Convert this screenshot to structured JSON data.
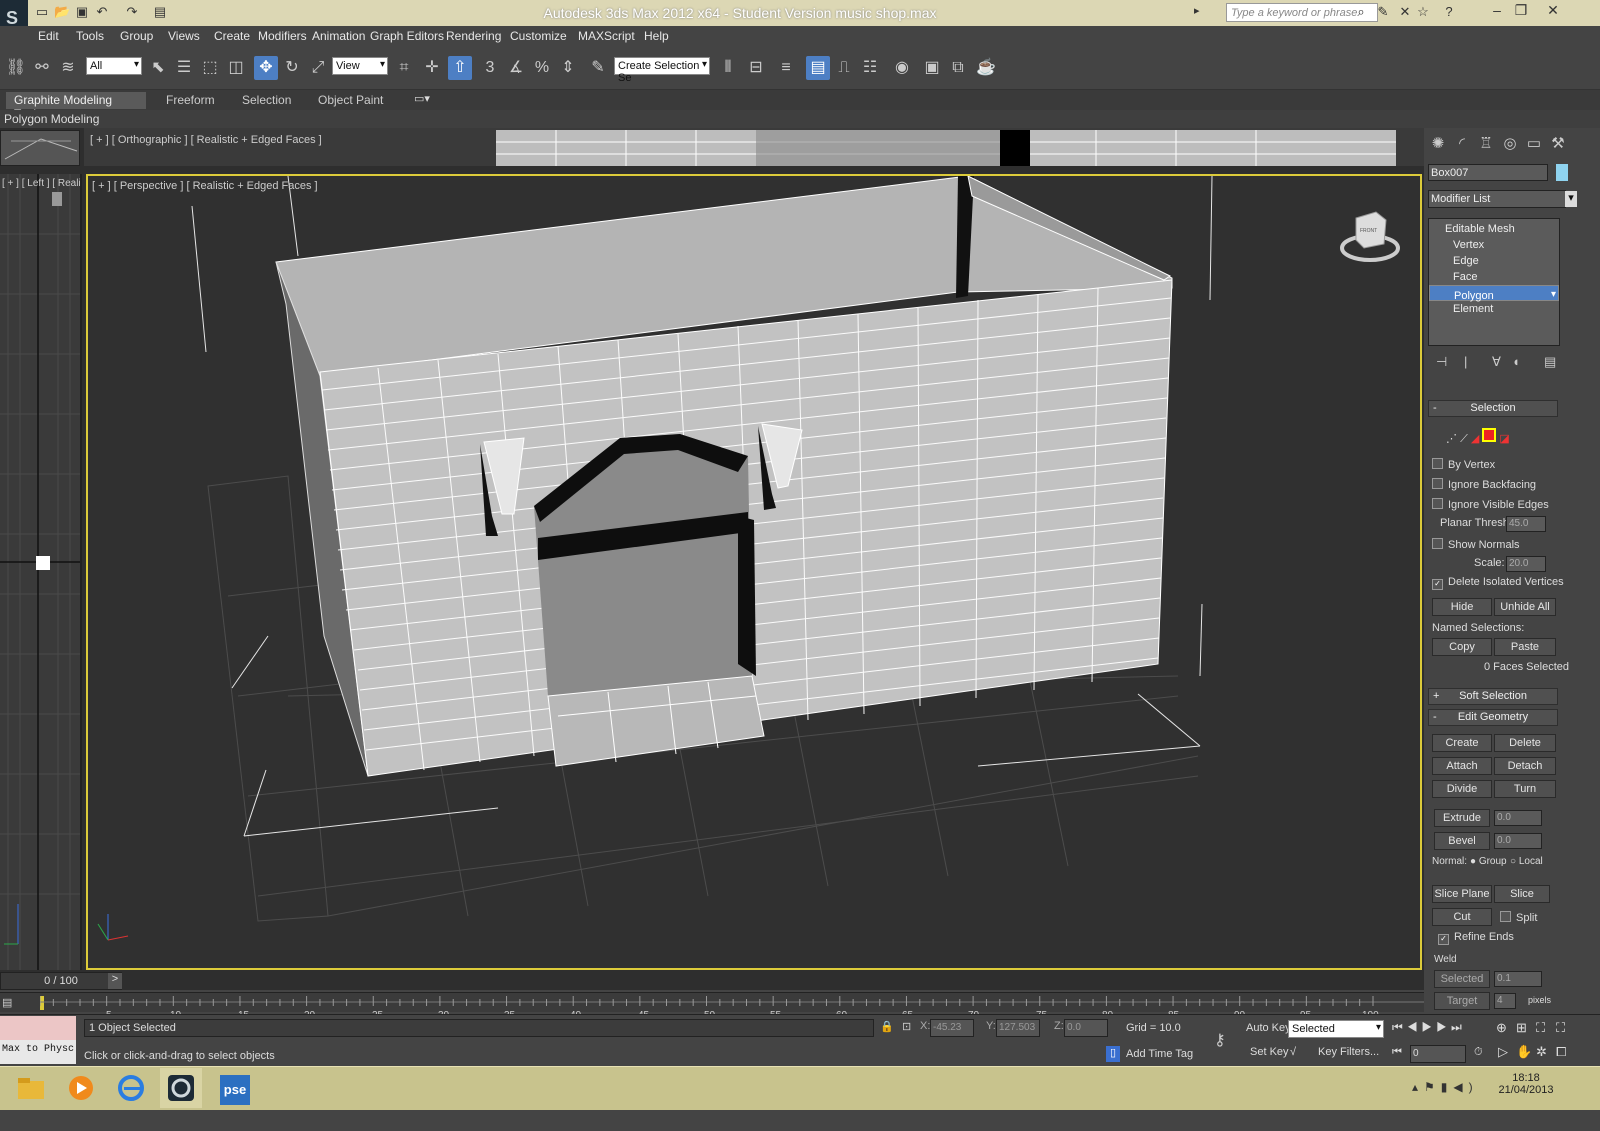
{
  "window": {
    "title": "Autodesk 3ds Max  2012 x64  - Student Version    music shop.max",
    "search_placeholder": "Type a keyword or phrase",
    "logo_letter": "S"
  },
  "menu": [
    "Edit",
    "Tools",
    "Group",
    "Views",
    "Create",
    "Modifiers",
    "Animation",
    "Graph Editors",
    "Rendering",
    "Customize",
    "MAXScript",
    "Help"
  ],
  "toolbar": {
    "selection_filter": "All",
    "ref_coord": "View",
    "named_selection": "Create Selection Se",
    "snap_3": "3",
    "snap_percent": "%"
  },
  "ribbon": {
    "tabs": [
      "Graphite Modeling Tools",
      "Freeform",
      "Selection",
      "Object Paint"
    ],
    "subpanel": "Polygon Modeling"
  },
  "viewports": {
    "ortho_label": "[ + ] [ Orthographic ] [ Realistic + Edged Faces ]",
    "left_label": "[ + ] [ Left ] [ Realisti",
    "persp_label": "[ + ] [ Perspective ] [ Realistic + Edged Faces ]",
    "viewcube_label": "FRONT"
  },
  "command_panel": {
    "object_name": "Box007",
    "object_color": "#8fd3ef",
    "modifier_list": "Modifier List",
    "stack": [
      {
        "label": "Editable Mesh",
        "top": true
      },
      {
        "label": "Vertex"
      },
      {
        "label": "Edge"
      },
      {
        "label": "Face"
      },
      {
        "label": "Polygon",
        "selected": true
      },
      {
        "label": "Element"
      }
    ],
    "selection": {
      "header": "Selection",
      "by_vertex": "By Vertex",
      "ignore_backfacing": "Ignore Backfacing",
      "ignore_visible_edges": "Ignore Visible Edges",
      "planar_thresh_label": "Planar Thresh:",
      "planar_thresh": "45.0",
      "show_normals": "Show Normals",
      "scale_label": "Scale:",
      "scale": "20.0",
      "delete_isolated": "Delete Isolated Vertices",
      "hide": "Hide",
      "unhide_all": "Unhide All",
      "named_selections": "Named Selections:",
      "copy": "Copy",
      "paste": "Paste",
      "faces_selected": "0 Faces Selected"
    },
    "soft_selection": "Soft Selection",
    "edit_geometry": {
      "header": "Edit Geometry",
      "create": "Create",
      "delete": "Delete",
      "attach": "Attach",
      "detach": "Detach",
      "divide": "Divide",
      "turn": "Turn",
      "extrude": "Extrude",
      "extrude_val": "0.0",
      "bevel": "Bevel",
      "bevel_val": "0.0",
      "normal_label": "Normal:",
      "group": "Group",
      "local": "Local",
      "slice_plane": "Slice Plane",
      "slice": "Slice",
      "cut": "Cut",
      "split": "Split",
      "refine_ends": "Refine Ends",
      "weld": "Weld",
      "selected": "Selected",
      "selected_val": "0.1",
      "target": "Target",
      "target_val": "4",
      "pixels": "pixels"
    }
  },
  "timeline": {
    "slider": "0 / 100",
    "ticks": [
      "5",
      "10",
      "15",
      "20",
      "25",
      "30",
      "35",
      "40",
      "45",
      "50",
      "55",
      "60",
      "65",
      "70",
      "75",
      "80",
      "85",
      "90",
      "95",
      "100"
    ]
  },
  "status": {
    "maxscript": "Max to Physc",
    "objects_selected": "1 Object Selected",
    "prompt": "Click or click-and-drag to select objects",
    "x_label": "X:",
    "x": "-45.23",
    "y_label": "Y:",
    "y": "127.503",
    "z_label": "Z:",
    "z": "0.0",
    "grid": "Grid = 10.0",
    "add_time_tag": "Add Time Tag",
    "auto_key": "Auto Key",
    "auto_key_mode": "Selected",
    "set_key": "Set Key",
    "key_filters": "Key Filters...",
    "frame": "0"
  },
  "taskbar": {
    "apps": [
      "explorer-icon",
      "media-player-icon",
      "ie-icon",
      "3dsmax-icon",
      "photoshop-icon"
    ],
    "pse_label": "pse",
    "time": "18:18",
    "date": "21/04/2013"
  }
}
